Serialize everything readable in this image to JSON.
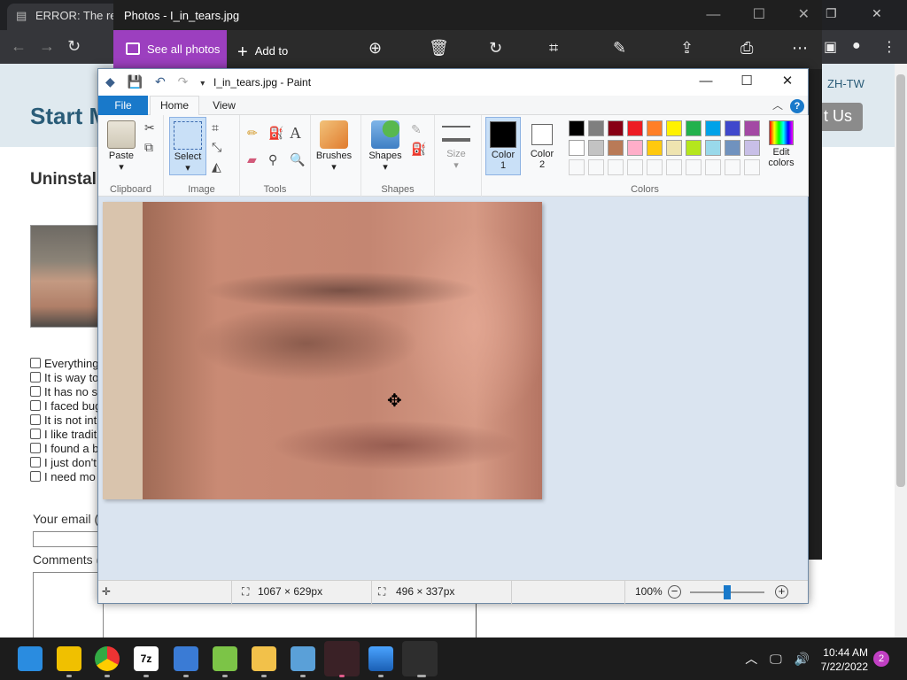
{
  "browser": {
    "tab_title": "ERROR: The req",
    "page_title": "Start M",
    "lang_link": "ZH-TW",
    "contact_button": "t Us",
    "section_heading": "Uninstal",
    "checkboxes": [
      "Everything",
      "It is way to",
      "It has no s",
      "I faced bug",
      "It is not int",
      "I like tradit",
      "I found a b",
      "I just don't",
      "I need mo"
    ],
    "email_label": "Your email (r",
    "comments_label": "Comments (r"
  },
  "photos": {
    "title": "Photos - I_in_tears.jpg",
    "see_all": "See all photos",
    "add_to": "Add to"
  },
  "paint": {
    "title": "I_in_tears.jpg - Paint",
    "tabs": {
      "file": "File",
      "home": "Home",
      "view": "View"
    },
    "groups": {
      "clipboard": "Clipboard",
      "image": "Image",
      "tools": "Tools",
      "shapes": "Shapes",
      "colors": "Colors"
    },
    "buttons": {
      "paste": "Paste",
      "select": "Select",
      "brushes": "Brushes",
      "shapes": "Shapes",
      "size": "Size",
      "color1_a": "Color",
      "color1_b": "1",
      "color2_a": "Color",
      "color2_b": "2",
      "edit_colors_a": "Edit",
      "edit_colors_b": "colors"
    },
    "color1": "#000000",
    "color2": "#ffffff",
    "palette_row1": [
      "#000000",
      "#7f7f7f",
      "#880015",
      "#ed1c24",
      "#ff7f27",
      "#fff200",
      "#22b14c",
      "#00a2e8",
      "#3f48cc",
      "#a349a4"
    ],
    "palette_row2": [
      "#ffffff",
      "#c3c3c3",
      "#b97a57",
      "#ffaec9",
      "#ffc90e",
      "#efe4b0",
      "#b5e61d",
      "#99d9ea",
      "#7092be",
      "#c8bfe7"
    ],
    "status": {
      "image_size": "1067 × 629px",
      "selection_size": "496 × 337px",
      "zoom": "100%"
    }
  },
  "taskbar": {
    "time": "10:44 AM",
    "date": "7/22/2022",
    "notifications": "2"
  }
}
